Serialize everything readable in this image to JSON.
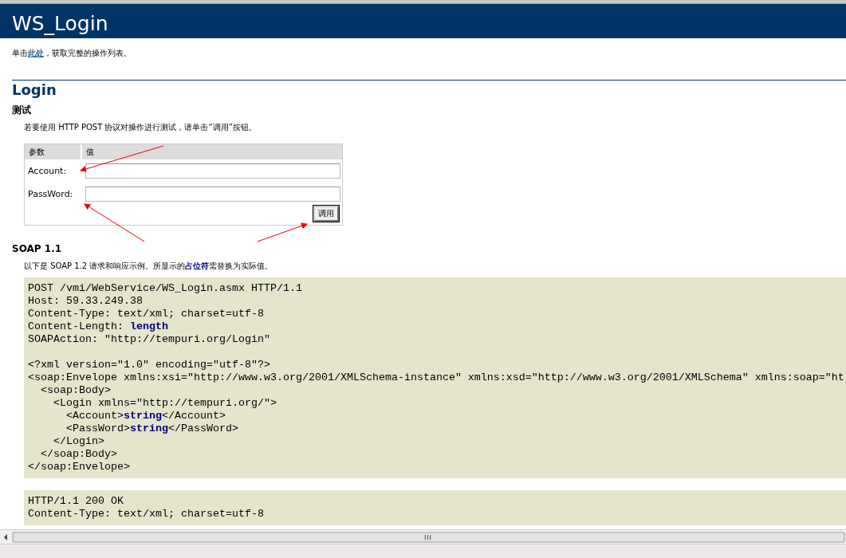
{
  "page": {
    "title": "WS_Login"
  },
  "intro": {
    "before": "单击",
    "link": "此处",
    "after": "，获取完整的操作列表。"
  },
  "operation": {
    "name": "Login"
  },
  "test": {
    "heading": "测试",
    "description": "若要使用 HTTP POST 协议对操作进行测试，请单击“调用”按钮。",
    "columns": [
      "参数",
      "值"
    ],
    "params": [
      {
        "label": "Account:"
      },
      {
        "label": "PassWord:"
      }
    ],
    "button": "调用"
  },
  "soap": {
    "heading": "SOAP 1.1",
    "note": "以下是 SOAP 1.2 请求和响应示例。所显示的**占位符**需替换为实际值。",
    "request": {
      "headers": [
        "POST /vmi/WebService/WS_Login.asmx HTTP/1.1",
        "Host: 59.33.249.38",
        "Content-Type: text/xml; charset=utf-8",
        "Content-Length: **length**",
        "SOAPAction: \"http://tempuri.org/Login\""
      ],
      "body": [
        "<?xml version=\"1.0\" encoding=\"utf-8\"?>",
        "<soap:Envelope xmlns:xsi=\"http://www.w3.org/2001/XMLSchema-instance\" xmlns:xsd=\"http://www.w3.org/2001/XMLSchema\" xmlns:soap=\"ht",
        "  <soap:Body>",
        "    <Login xmlns=\"http://tempuri.org/\">",
        "      <Account>**string**</Account>",
        "      <PassWord>**string**</PassWord>",
        "    </Login>",
        "  </soap:Body>",
        "</soap:Envelope>"
      ]
    },
    "response": {
      "headers": [
        "HTTP/1.1 200 OK",
        "Content-Type: text/xml; charset=utf-8"
      ]
    }
  }
}
